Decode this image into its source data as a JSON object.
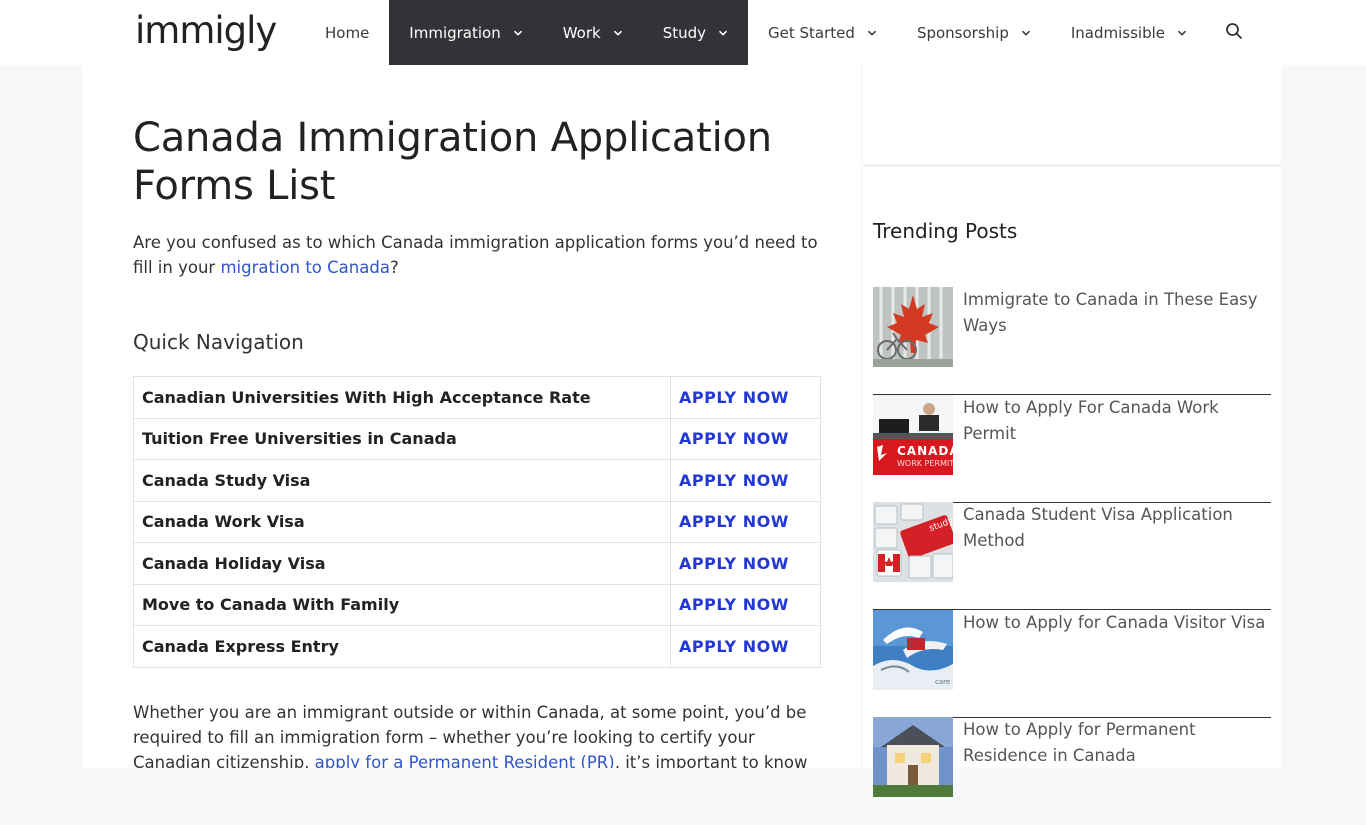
{
  "header": {
    "logo": "immigly",
    "nav": [
      {
        "label": "Home",
        "dropdown": false,
        "dark": false
      },
      {
        "label": "Immigration",
        "dropdown": true,
        "dark": true
      },
      {
        "label": "Work",
        "dropdown": true,
        "dark": true
      },
      {
        "label": "Study",
        "dropdown": true,
        "dark": true
      },
      {
        "label": "Get Started",
        "dropdown": true,
        "dark": false
      },
      {
        "label": "Sponsorship",
        "dropdown": true,
        "dark": false
      },
      {
        "label": "Inadmissible",
        "dropdown": true,
        "dark": false
      }
    ],
    "search_icon": "search-icon"
  },
  "article": {
    "title": "Canada Immigration Application Forms List",
    "intro_before": "Are you confused as to which Canada immigration application forms you’d need to fill in your ",
    "intro_link": "migration to Canada",
    "intro_after": "?",
    "quick_nav_heading": "Quick Navigation",
    "quick_nav": [
      {
        "label": "Canadian Universities With High Acceptance Rate",
        "action": "APPLY NOW"
      },
      {
        "label": "Tuition Free Universities in Canada",
        "action": "APPLY NOW"
      },
      {
        "label": "Canada Study Visa",
        "action": "APPLY NOW"
      },
      {
        "label": "Canada Work Visa",
        "action": "APPLY NOW"
      },
      {
        "label": "Canada Holiday Visa",
        "action": "APPLY NOW"
      },
      {
        "label": "Move to Canada With Family",
        "action": "APPLY NOW"
      },
      {
        "label": "Canada Express Entry",
        "action": "APPLY NOW"
      }
    ],
    "body_before": "Whether you are an immigrant outside or within Canada, at some point, you’d be required to fill an immigration form – whether you’re looking to certify your Canadian citizenship, ",
    "body_link": "apply for a Permanent Resident (PR)",
    "body_after": ", it’s important to know exactly which"
  },
  "sidebar": {
    "title": "Trending Posts",
    "posts": [
      {
        "title": "Immigrate to Canada in These Easy Ways"
      },
      {
        "title": "How to Apply For Canada Work Permit",
        "thumb_text_1": "CANADA",
        "thumb_text_2": "WORK PERMIT"
      },
      {
        "title": "Canada Student Visa Application Method",
        "thumb_text_1": "study"
      },
      {
        "title": "How to Apply for Canada Visitor Visa",
        "thumb_text_1": "care"
      },
      {
        "title": "How to Apply for Permanent Residence in Canada"
      }
    ]
  },
  "colors": {
    "nav_dark": "#323237",
    "link": "#2f55c8",
    "apply": "#2238d6"
  }
}
